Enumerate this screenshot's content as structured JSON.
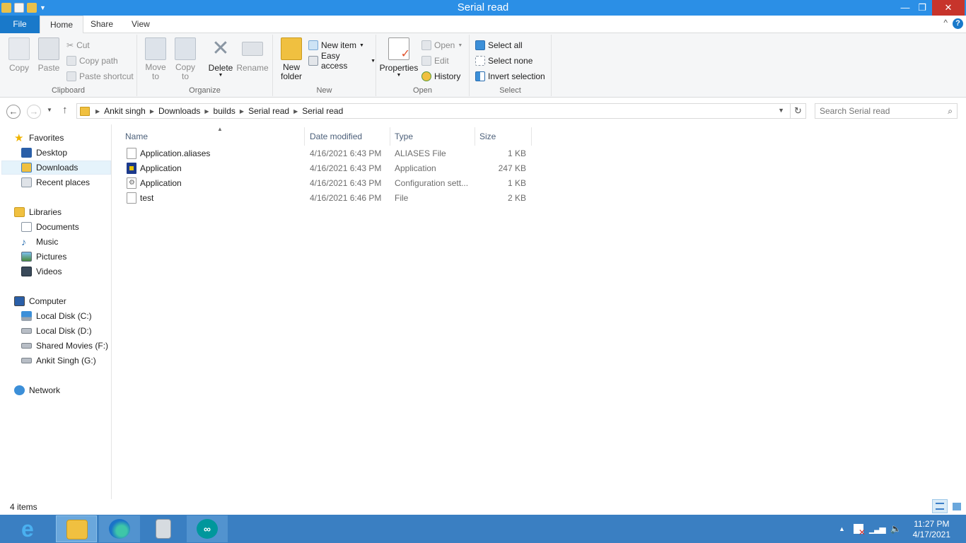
{
  "window": {
    "title": "Serial read",
    "min_glyph": "—",
    "max_glyph": "❐",
    "close_glyph": "✕",
    "help_glyph": "?",
    "collapse_glyph": "^"
  },
  "ribbon_tabs": [
    {
      "label": "File"
    },
    {
      "label": "Home"
    },
    {
      "label": "Share"
    },
    {
      "label": "View"
    }
  ],
  "ribbon": {
    "clipboard": {
      "label": "Clipboard",
      "copy": "Copy",
      "paste": "Paste",
      "cut": "Cut",
      "copy_path": "Copy path",
      "paste_shortcut": "Paste shortcut"
    },
    "organize": {
      "label": "Organize",
      "move_to_1": "Move",
      "move_to_2": "to",
      "copy_to_1": "Copy",
      "copy_to_2": "to",
      "delete": "Delete",
      "rename": "Rename"
    },
    "new": {
      "label": "New",
      "new_folder_1": "New",
      "new_folder_2": "folder",
      "new_item": "New item",
      "easy_access": "Easy access"
    },
    "open": {
      "label": "Open",
      "properties": "Properties",
      "open": "Open",
      "edit": "Edit",
      "history": "History"
    },
    "select": {
      "label": "Select",
      "select_all": "Select all",
      "select_none": "Select none",
      "invert_selection": "Invert selection"
    }
  },
  "address": {
    "crumbs": [
      "Ankit singh",
      "Downloads",
      "builds",
      "Serial read",
      "Serial read"
    ],
    "search_placeholder": "Search Serial read"
  },
  "nav": {
    "favorites": "Favorites",
    "desktop": "Desktop",
    "downloads": "Downloads",
    "recent": "Recent places",
    "libraries": "Libraries",
    "documents": "Documents",
    "music": "Music",
    "pictures": "Pictures",
    "videos": "Videos",
    "computer": "Computer",
    "disk_c": "Local Disk (C:)",
    "disk_d": "Local Disk (D:)",
    "disk_f": "Shared Movies (F:)",
    "disk_g": "Ankit Singh (G:)",
    "network": "Network"
  },
  "columns": {
    "name": "Name",
    "date": "Date modified",
    "type": "Type",
    "size": "Size"
  },
  "files": [
    {
      "name": "Application.aliases",
      "date": "4/16/2021 6:43 PM",
      "type": "ALIASES File",
      "size": "1 KB"
    },
    {
      "name": "Application",
      "date": "4/16/2021 6:43 PM",
      "type": "Application",
      "size": "247 KB"
    },
    {
      "name": "Application",
      "date": "4/16/2021 6:43 PM",
      "type": "Configuration sett...",
      "size": "1 KB"
    },
    {
      "name": "test",
      "date": "4/16/2021 6:46 PM",
      "type": "File",
      "size": "2 KB"
    }
  ],
  "status": {
    "item_count": "4 items"
  },
  "taskbar": {
    "time": "11:27 PM",
    "date": "4/17/2021"
  },
  "colors": {
    "titlebar": "#2b8fe6",
    "file_tab": "#1979ca",
    "taskbar": "#3a7fc2",
    "close_button": "#c7342b"
  }
}
